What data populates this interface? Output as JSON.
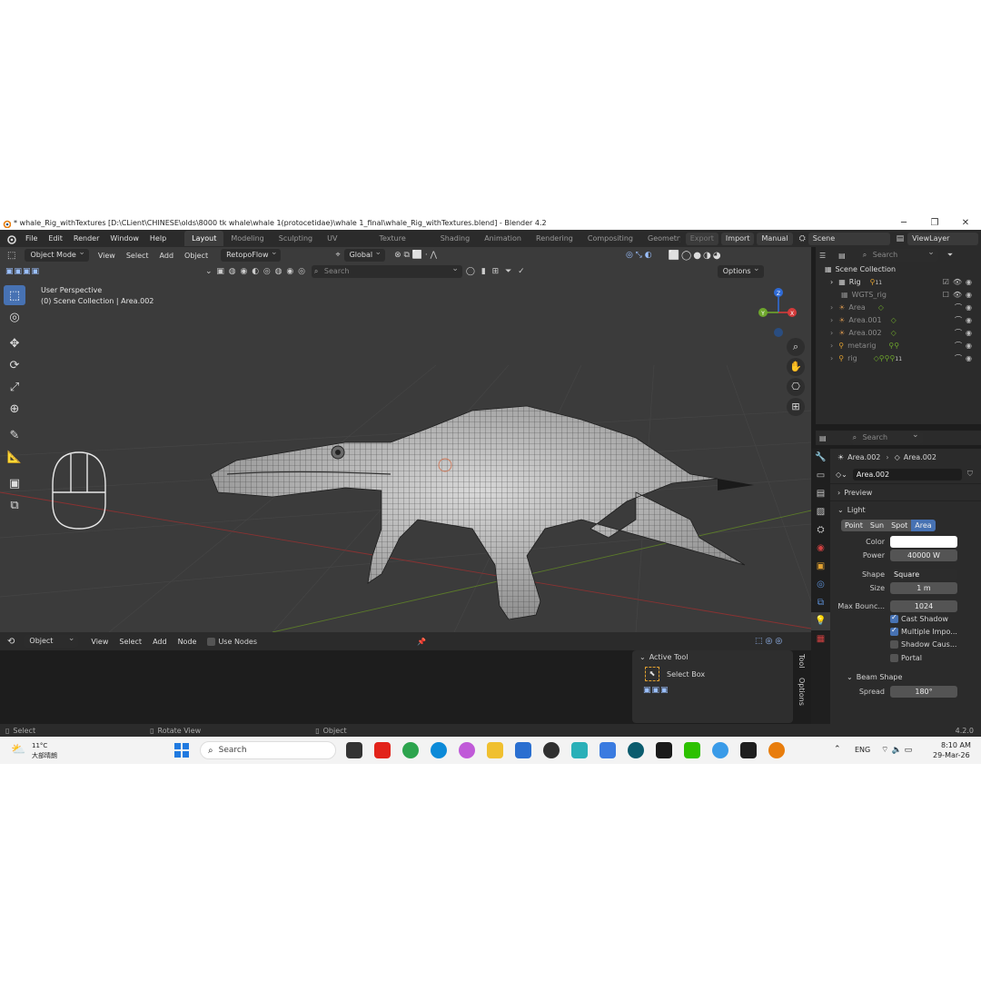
{
  "window": {
    "title": "* whale_Rig_withTextures [D:\\CLient\\CHINESE\\olds\\8000 tk whale\\whale 1(protocetidae)\\whale 1_final\\whale_Rig_withTextures.blend] - Blender 4.2",
    "controls": [
      "─",
      "❐",
      "✕"
    ]
  },
  "menu": [
    "File",
    "Edit",
    "Render",
    "Window",
    "Help"
  ],
  "workspaces": [
    "Layout",
    "Modeling",
    "Sculpting",
    "UV Editing",
    "Texture Paint",
    "Shading",
    "Animation",
    "Rendering",
    "Compositing",
    "Geometry N"
  ],
  "header_right": {
    "export": "Export",
    "import": "Import",
    "manual": "Manual",
    "scene": "Scene",
    "view_layer": "ViewLayer"
  },
  "viewport": {
    "mode": "Object Mode",
    "menus": [
      "View",
      "Select",
      "Add",
      "Object"
    ],
    "retopo": "RetopoFlow",
    "orientation": "Global",
    "search_placeholder": "Search",
    "options": "Options",
    "info_line1": "User Perspective",
    "info_line2": "(0) Scene Collection | Area.002",
    "gizmo": {
      "z": "Z",
      "x": "X",
      "y": "Y"
    }
  },
  "node_editor": {
    "type": "Object",
    "menus": [
      "View",
      "Select",
      "Add",
      "Node"
    ],
    "use_nodes": "Use Nodes",
    "active_tool_title": "Active Tool",
    "active_tool_name": "Select Box",
    "side_tabs": [
      "Tool",
      "Options"
    ]
  },
  "status": {
    "select": "Select",
    "rotate": "Rotate View",
    "object": "Object",
    "version": "4.2.0"
  },
  "outliner": {
    "search_placeholder": "Search",
    "root": "Scene Collection",
    "items": [
      {
        "name": "Rig",
        "extra": "11",
        "checked": true
      },
      {
        "name": "WGTS_rig",
        "extra": "",
        "checked": false
      },
      {
        "name": "Area",
        "extra": "",
        "checked": null
      },
      {
        "name": "Area.001",
        "extra": "",
        "checked": null
      },
      {
        "name": "Area.002",
        "extra": "",
        "checked": null
      },
      {
        "name": "metarig",
        "extra": "",
        "checked": null
      },
      {
        "name": "rig",
        "extra": "11",
        "checked": null
      }
    ]
  },
  "properties": {
    "search_placeholder": "Search",
    "breadcrumb_obj": "Area.002",
    "breadcrumb_data": "Area.002",
    "datablock": "Area.002",
    "preview": "Preview",
    "light": "Light",
    "light_types": [
      "Point",
      "Sun",
      "Spot",
      "Area"
    ],
    "active_light_type": "Area",
    "color_label": "Color",
    "power_label": "Power",
    "power_value": "40000 W",
    "shape_label": "Shape",
    "shape_value": "Square",
    "size_label": "Size",
    "size_value": "1 m",
    "max_bounce_label": "Max Bounc...",
    "max_bounce_value": "1024",
    "cast_shadow": "Cast Shadow",
    "multiple_importance": "Multiple Impo...",
    "shadow_caustics": "Shadow Caus...",
    "portal": "Portal",
    "beam_shape": "Beam Shape",
    "spread_label": "Spread",
    "spread_value": "180°"
  },
  "taskbar": {
    "temp": "11°C",
    "weather": "大部晴朗",
    "search": "Search",
    "lang": "ENG",
    "time": "8:10 AM",
    "date": "29-Mar-26"
  }
}
